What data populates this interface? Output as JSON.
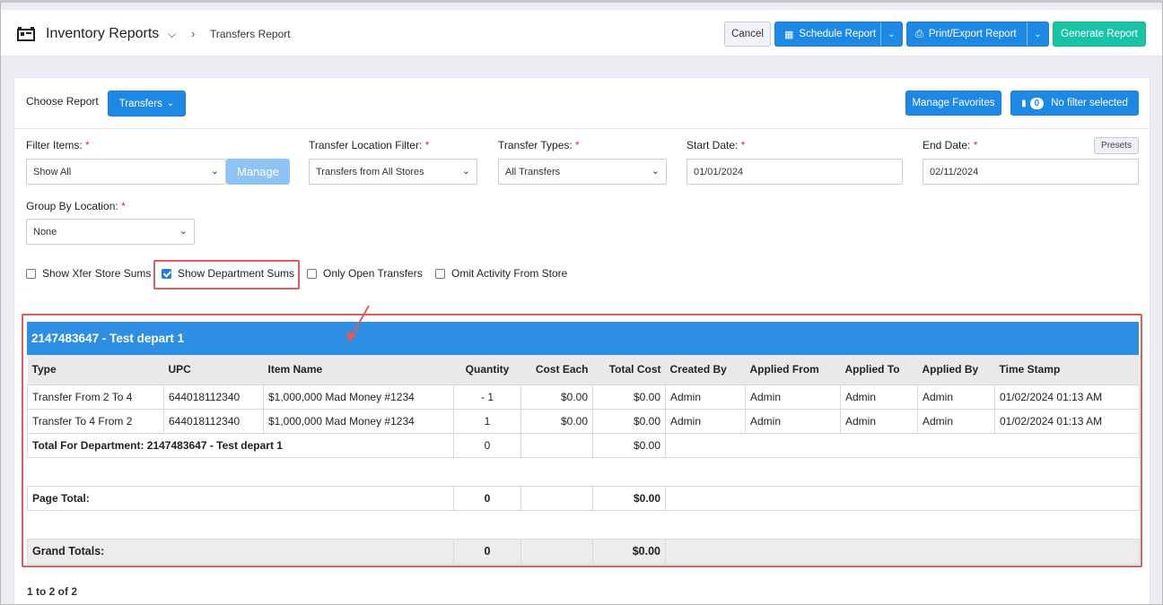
{
  "header": {
    "app_title": "Inventory Reports",
    "breadcrumb": "Transfers Report",
    "cancel": "Cancel",
    "schedule": "Schedule Report",
    "print_export": "Print/Export Report",
    "generate": "Generate Report"
  },
  "report": {
    "choose_label": "Choose Report",
    "selected": "Transfers",
    "manage_favorites": "Manage Favorites",
    "filter_count": "0",
    "filter_text": "No filter selected"
  },
  "filters": {
    "filter_items_label": "Filter Items:",
    "filter_items_value": "Show All",
    "manage": "Manage",
    "location_label": "Transfer Location Filter:",
    "location_value": "Transfers from All Stores",
    "types_label": "Transfer Types:",
    "types_value": "All Transfers",
    "start_label": "Start Date:",
    "start_value": "01/01/2024",
    "end_label": "End Date:",
    "end_value": "02/11/2024",
    "presets": "Presets",
    "group_label": "Group By Location:",
    "group_value": "None",
    "required_mark": "*"
  },
  "options": [
    {
      "label": "Show Xfer Store Sums",
      "checked": false
    },
    {
      "label": "Show Department Sums",
      "checked": true
    },
    {
      "label": "Only Open Transfers",
      "checked": false
    },
    {
      "label": "Omit Activity From Store",
      "checked": false
    }
  ],
  "table": {
    "department": "2147483647 - Test depart 1",
    "columns": [
      "Type",
      "UPC",
      "Item Name",
      "Quantity",
      "Cost Each",
      "Total Cost",
      "Created By",
      "Applied From",
      "Applied To",
      "Applied By",
      "Time Stamp"
    ],
    "rows": [
      [
        "Transfer From 2 To 4",
        "644018112340",
        "$1,000,000 Mad Money #1234",
        "- 1",
        "$0.00",
        "$0.00",
        "Admin",
        "Admin",
        "Admin",
        "Admin",
        "01/02/2024 01:13 AM"
      ],
      [
        "Transfer To 4 From 2",
        "644018112340",
        "$1,000,000 Mad Money #1234",
        "1",
        "$0.00",
        "$0.00",
        "Admin",
        "Admin",
        "Admin",
        "Admin",
        "01/02/2024 01:13 AM"
      ]
    ],
    "dept_total_label": "Total For Department: 2147483647 - Test depart 1",
    "dept_total_qty": "0",
    "dept_total_cost": "$0.00",
    "page_total_label": "Page Total:",
    "page_total_qty": "0",
    "page_total_cost": "$0.00",
    "grand_label": "Grand Totals:",
    "grand_qty": "0",
    "grand_cost": "$0.00"
  },
  "pager": "1 to 2 of 2",
  "colors": {
    "primary": "#1e88e5",
    "generate": "#18c3a6",
    "highlight": "#e05b5b",
    "dept_header": "#2d8ee3"
  }
}
